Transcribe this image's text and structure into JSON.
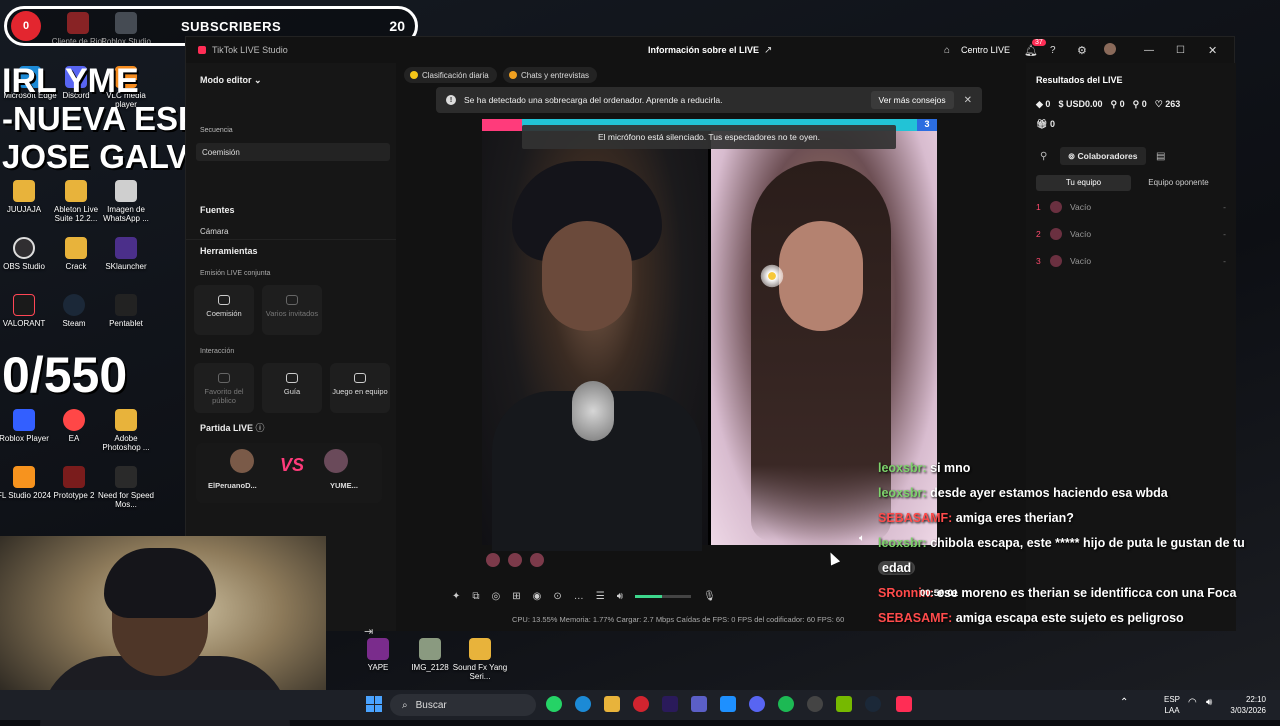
{
  "overlay": {
    "subscribers_label": "SUBSCRIBERS",
    "subscribers_count": "20",
    "rec_label": "0",
    "stream_title_line1": "IRL YME",
    "stream_title_line2": "-NUEVA ESPERANZA",
    "stream_title_line3": "JOSE GALVEZ",
    "goal": "0/550"
  },
  "desktop_icons": [
    {
      "label": "Cliente de Riot"
    },
    {
      "label": "Roblox Studio"
    },
    {
      "label": "Microsoft Edge"
    },
    {
      "label": "Discord"
    },
    {
      "label": "VLC media player"
    },
    {
      "label": "JUUJAJA"
    },
    {
      "label": "Ableton Live Suite 12.2..."
    },
    {
      "label": "Imagen de WhatsApp ..."
    },
    {
      "label": "OBS Studio"
    },
    {
      "label": "Crack"
    },
    {
      "label": "SKlauncher"
    },
    {
      "label": "VALORANT"
    },
    {
      "label": "Steam"
    },
    {
      "label": "Pentablet"
    },
    {
      "label": "Roblox Player"
    },
    {
      "label": "EA"
    },
    {
      "label": "Adobe Photoshop ..."
    },
    {
      "label": "FL Studio 2024"
    },
    {
      "label": "Prototype 2"
    },
    {
      "label": "Need for Speed Mos..."
    },
    {
      "label": "YAPE"
    },
    {
      "label": "IMG_2128"
    },
    {
      "label": "Sound Fx Yang Seri..."
    }
  ],
  "app": {
    "window_title": "TikTok LIVE Studio",
    "center_title": "Información sobre el LIVE",
    "centro_label": "Centro LIVE",
    "notif_count": "37",
    "mode_editor": "Modo editor",
    "secuencia": "Secuencia",
    "coemision_scene": "Coemisión",
    "fuentes": "Fuentes",
    "camara": "Cámara",
    "herramientas": "Herramientas",
    "emision_conjunta": "Emisión LIVE conjunta",
    "tools_row1": [
      {
        "label": "Coemisión",
        "enabled": true,
        "icon": "link-icon"
      },
      {
        "label": "Varios invitados",
        "enabled": false,
        "icon": "people-icon"
      }
    ],
    "interaccion": "Interacción",
    "tools_row2": [
      {
        "label": "Favorito del público",
        "enabled": false,
        "icon": "star-icon"
      },
      {
        "label": "Guía",
        "enabled": true,
        "icon": "book-icon"
      },
      {
        "label": "Juego en equipo",
        "enabled": true,
        "icon": "team-icon"
      }
    ],
    "partida_live": "Partida LIVE",
    "player_left": "ElPeruanoD...",
    "player_right": "YUME...",
    "vs": "VS",
    "pill_ranking": "Clasificación diaria",
    "pill_chats": "Chats y entrevistas",
    "notice_text": "Se ha detectado una sobrecarga del ordenador. Aprende a reducirla.",
    "notice_button": "Ver más consejos",
    "muted_text": "El micrófono está silenciado. Tus espectadores no te oyen.",
    "score_right": "3",
    "status_bar": "CPU: 13.55%     Memoria: 1.77%     Cargar: 2.7 Mbps     Caídas de FPS: 0     FPS del codificador: 60     FPS: 60",
    "volume_level": 0.48,
    "timer": "00:50:01"
  },
  "results": {
    "title": "Resultados del LIVE",
    "stats": [
      "0",
      "USD0.00",
      "0",
      "0",
      "263"
    ],
    "gifts": "0",
    "colaboradores": "Colaboradores",
    "tab_team": "Tu equipo",
    "tab_opponent": "Equipo oponente",
    "slots": [
      {
        "n": "1",
        "label": "Vacío",
        "dash": "-"
      },
      {
        "n": "2",
        "label": "Vacío",
        "dash": "-"
      },
      {
        "n": "3",
        "label": "Vacío",
        "dash": "-"
      }
    ]
  },
  "chat": [
    {
      "user": "leoxsbr:",
      "msg": "si mno",
      "color": "green"
    },
    {
      "user": "leoxsbr:",
      "msg": "desde ayer estamos haciendo esa wbda",
      "color": "green"
    },
    {
      "user": "SEBASAMF:",
      "msg": "amiga eres therian?",
      "color": "red"
    },
    {
      "user": "leoxsbr:",
      "msg": "chibola escapa, este ***** hijo de puta le gustan de tu",
      "color": "green"
    },
    {
      "user": "",
      "msg": "edad",
      "color": "green"
    },
    {
      "user": "SRonnin:",
      "msg": "ese moreno es therian se identificca con una Foca",
      "color": "red"
    },
    {
      "user": "SEBASAMF:",
      "msg": "amiga escapa este sujeto es peligroso",
      "color": "red"
    }
  ],
  "taskbar": {
    "search_placeholder": "Buscar",
    "lang": "ESP",
    "lang2": "LAA",
    "time": "22:10",
    "date": "3/03/2026"
  },
  "colors": {
    "accent": "#ff2d55",
    "chat_green": "#7dd26b",
    "chat_red": "#ff4b4b"
  }
}
